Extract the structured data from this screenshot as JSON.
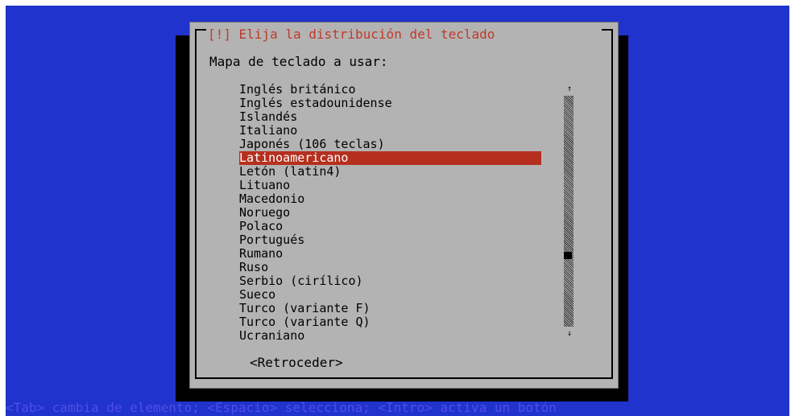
{
  "dialog": {
    "title": "[!] Elija la distribución del teclado",
    "prompt": "Mapa de teclado a usar:",
    "items": [
      "Inglés británico",
      "Inglés estadounidense",
      "Islandés",
      "Italiano",
      "Japonés (106 teclas)",
      "Latinoamericano",
      "Letón (latin4)",
      "Lituano",
      "Macedonio",
      "Noruego",
      "Polaco",
      "Portugués",
      "Rumano",
      "Ruso",
      "Serbio (cirílico)",
      "Sueco",
      "Turco (variante F)",
      "Turco (variante Q)",
      "Ucraniano"
    ],
    "selected_item": "Latinoamericano",
    "back_button": "<Retroceder>"
  },
  "footer": {
    "help_text": "<Tab> cambia de elemento; <Espacio> selecciona; <Intro> activa un botón"
  },
  "colors": {
    "background": "#2033cc",
    "dialog": "#b3b3b3",
    "selected": "#b52f1f",
    "title": "#c0392b",
    "footer": "#4f4fe6"
  }
}
